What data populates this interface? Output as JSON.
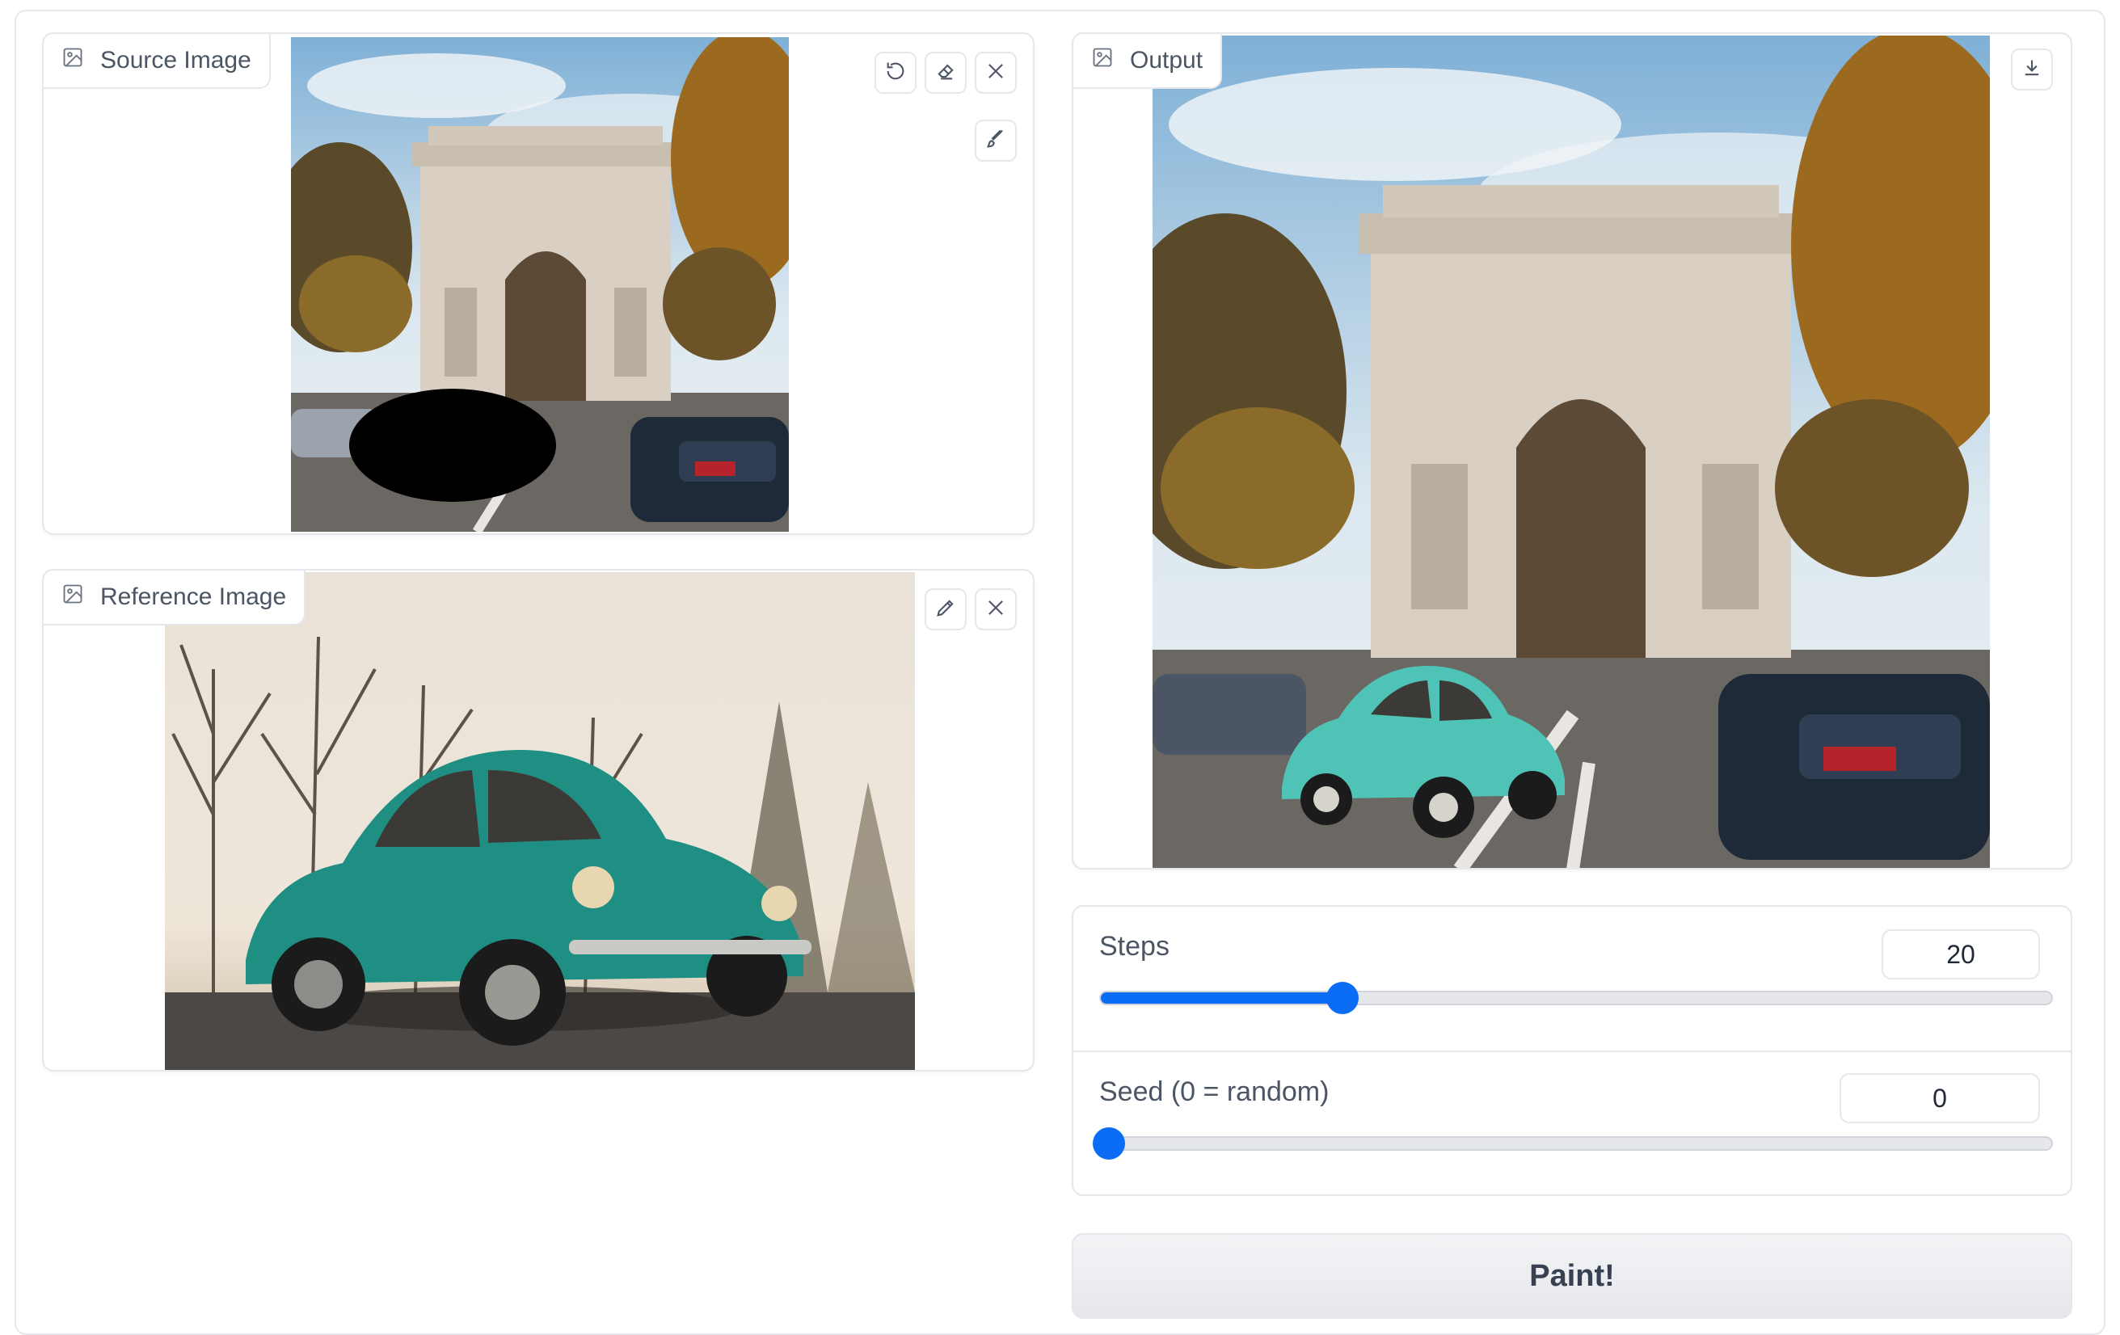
{
  "source_panel": {
    "label": "Source Image",
    "icon": "image-icon",
    "tools": [
      "undo-icon",
      "eraser-icon",
      "close-icon",
      "brush-icon"
    ]
  },
  "reference_panel": {
    "label": "Reference Image",
    "icon": "image-icon",
    "tools": [
      "pencil-icon",
      "close-icon"
    ]
  },
  "output_panel": {
    "label": "Output",
    "icon": "image-icon",
    "tools": [
      "download-icon"
    ]
  },
  "steps": {
    "label": "Steps",
    "value": "20",
    "fraction": 0.255
  },
  "seed": {
    "label": "Seed (0 = random)",
    "value": "0",
    "fraction": 0.0
  },
  "paint_button": {
    "label": "Paint!"
  },
  "colors": {
    "accent": "#0b6cf5",
    "border": "#e5e7eb",
    "button_bg": "#e5e7eb"
  }
}
